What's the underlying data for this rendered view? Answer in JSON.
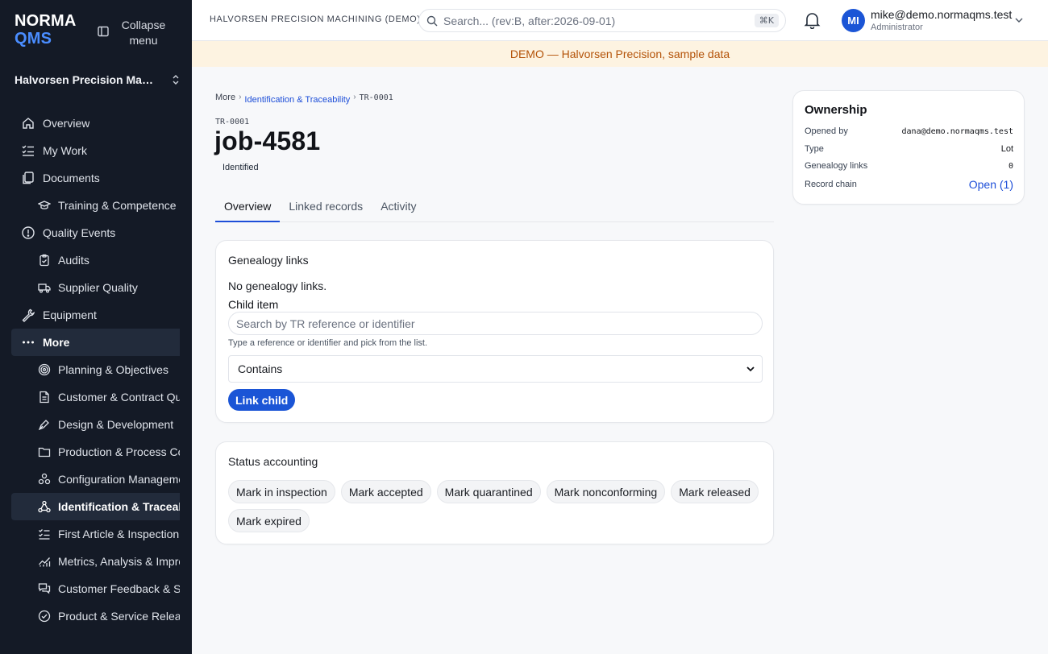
{
  "brand": {
    "line1": "NORMA",
    "line2": "QMS",
    "accent_color": "#4a8dff"
  },
  "sidebar": {
    "collapse_label": "Collapse menu",
    "org_name": "Halvorsen Precision Machining",
    "items": [
      {
        "label": "Overview",
        "icon": "home-icon"
      },
      {
        "label": "My Work",
        "icon": "checklist-icon"
      },
      {
        "label": "Documents",
        "icon": "documents-icon"
      },
      {
        "label": "Training & Competence",
        "icon": "graduation-cap-icon"
      },
      {
        "label": "Quality Events",
        "icon": "alert-circle-icon"
      },
      {
        "label": "Audits",
        "icon": "clipboard-check-icon"
      },
      {
        "label": "Supplier Quality",
        "icon": "truck-icon"
      },
      {
        "label": "Equipment",
        "icon": "wrench-icon"
      },
      {
        "label": "More",
        "icon": "more-dots-icon"
      },
      {
        "label": "Planning & Objectives",
        "icon": "target-icon"
      },
      {
        "label": "Customer & Contract Quality",
        "icon": "contract-icon"
      },
      {
        "label": "Design & Development",
        "icon": "pen-tool-icon"
      },
      {
        "label": "Production & Process Control",
        "icon": "folder-icon"
      },
      {
        "label": "Configuration Management",
        "icon": "components-icon"
      },
      {
        "label": "Identification & Traceability",
        "icon": "network-icon"
      },
      {
        "label": "First Article & Inspection Records",
        "icon": "list-checks-icon"
      },
      {
        "label": "Metrics, Analysis & Improvement",
        "icon": "chart-icon"
      },
      {
        "label": "Customer Feedback & Satisfaction",
        "icon": "messages-icon"
      },
      {
        "label": "Product & Service Release",
        "icon": "check-circle-icon"
      }
    ]
  },
  "topbar": {
    "org_label": "HALVORSEN PRECISION MACHINING (DEMO)",
    "search_placeholder": "Search... (rev:B, after:2026-09-01)",
    "shortcut": "⌘K",
    "avatar_initials": "MI",
    "user_email": "mike@demo.normaqms.test",
    "user_role": "Administrator"
  },
  "banner": "DEMO — Halvorsen Precision, sample data",
  "breadcrumb": {
    "root": "More",
    "section": "Identification & Traceability",
    "current": "TR-0001"
  },
  "record": {
    "code": "TR-0001",
    "title": "job-4581",
    "status": "Identified"
  },
  "tabs": [
    "Overview",
    "Linked records",
    "Activity"
  ],
  "genealogy": {
    "heading": "Genealogy links",
    "empty": "No genealogy links.",
    "child_label": "Child item",
    "child_placeholder": "Search by TR reference or identifier",
    "hint": "Type a reference or identifier and pick from the list.",
    "match_mode": "Contains",
    "link_button": "Link child"
  },
  "status_accounting": {
    "heading": "Status accounting",
    "actions": [
      "Mark in inspection",
      "Mark accepted",
      "Mark quarantined",
      "Mark nonconforming",
      "Mark released",
      "Mark expired"
    ]
  },
  "ownership": {
    "heading": "Ownership",
    "opened_by_label": "Opened by",
    "opened_by": "dana@demo.normaqms.test",
    "type_label": "Type",
    "type": "Lot",
    "genealogy_label": "Genealogy links",
    "genealogy_count": "0",
    "chain_label": "Record chain",
    "chain_link": "Open (1)"
  }
}
